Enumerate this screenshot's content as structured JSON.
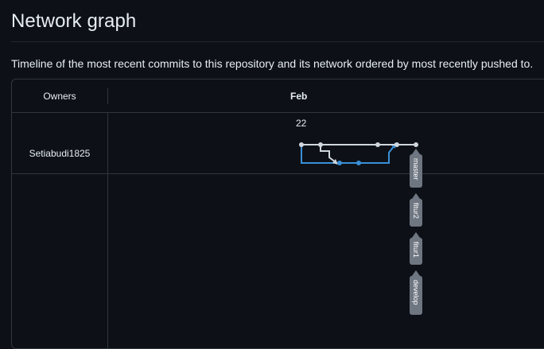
{
  "page": {
    "title": "Network graph",
    "description": "Timeline of the most recent commits to this repository and its network ordered by most recently pushed to."
  },
  "graph": {
    "header_owners": "Owners",
    "month": "Feb",
    "day": "22",
    "owner": "Setiabudi1825",
    "branches": [
      "master",
      "fitur2",
      "fitur1",
      "develop"
    ],
    "colors": {
      "main_line": "#d0d7de",
      "branch_line": "#3a8fd6",
      "label_bg": "#6e7681",
      "background": "#0d1117",
      "border": "#30363d"
    }
  }
}
